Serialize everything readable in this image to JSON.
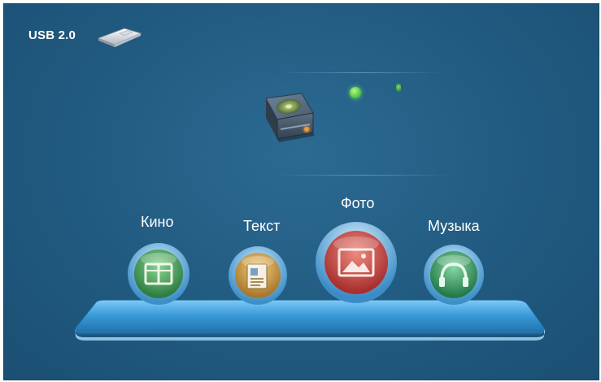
{
  "header": {
    "connection_label": "USB 2.0",
    "device_icon": "usb-stick-icon"
  },
  "status": {
    "drive_icon": "hard-drive-icon",
    "indicators": [
      {
        "name": "status-led",
        "color": "#46c23a"
      },
      {
        "name": "status-led-small",
        "color": "#2e8d3e"
      }
    ]
  },
  "menu": {
    "items": [
      {
        "label": "Кино",
        "icon": "film-icon",
        "color": "#3f9a52",
        "selected": false
      },
      {
        "label": "Текст",
        "icon": "document-icon",
        "color": "#c9a043",
        "selected": false
      },
      {
        "label": "Фото",
        "icon": "picture-icon",
        "color": "#c94a45",
        "selected": true
      },
      {
        "label": "Музыка",
        "icon": "headphones-icon",
        "color": "#3aa065",
        "selected": false
      }
    ]
  },
  "colors": {
    "background": "#215a80",
    "shelf": "#3a9ad8",
    "label": "#ffffff"
  }
}
